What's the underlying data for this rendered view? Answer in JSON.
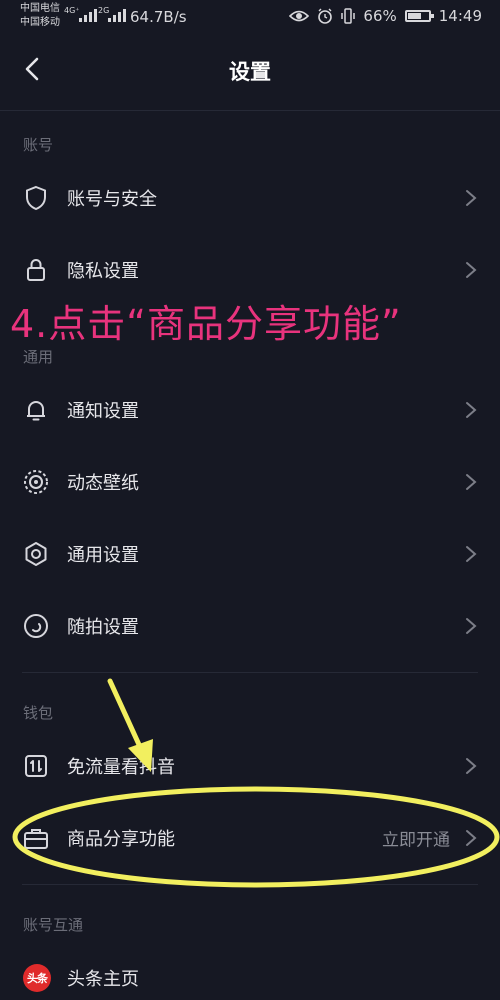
{
  "status_bar": {
    "carrier_1": "中国电信",
    "carrier_2": "中国移动",
    "net_type_1": "4G⁺",
    "net_type_2": "2G",
    "speed": "64.7B/s",
    "battery_percent": 66,
    "battery_text": "66%",
    "time": "14:49"
  },
  "nav": {
    "title": "设置"
  },
  "overlay": {
    "instruction": "4.点击“商品分享功能”",
    "color": "#e8337d",
    "highlight_color": "#f2ef5f"
  },
  "sections": [
    {
      "label": "账号",
      "items": [
        {
          "label": "账号与安全",
          "icon": "shield-icon"
        },
        {
          "label": "隐私设置",
          "icon": "lock-icon"
        }
      ]
    },
    {
      "label": "通用",
      "items": [
        {
          "label": "通知设置",
          "icon": "bell-icon"
        },
        {
          "label": "动态壁纸",
          "icon": "wallpaper-icon"
        },
        {
          "label": "通用设置",
          "icon": "gear-icon"
        },
        {
          "label": "随拍设置",
          "icon": "camera-icon"
        }
      ]
    },
    {
      "label": "钱包",
      "items": [
        {
          "label": "免流量看抖音",
          "icon": "data-icon"
        },
        {
          "label": "商品分享功能",
          "icon": "briefcase-icon",
          "value": "立即开通"
        }
      ]
    },
    {
      "label": "账号互通",
      "items": [
        {
          "label": "头条主页",
          "icon": "toutiao-icon",
          "icon_text": "头条"
        }
      ]
    }
  ]
}
